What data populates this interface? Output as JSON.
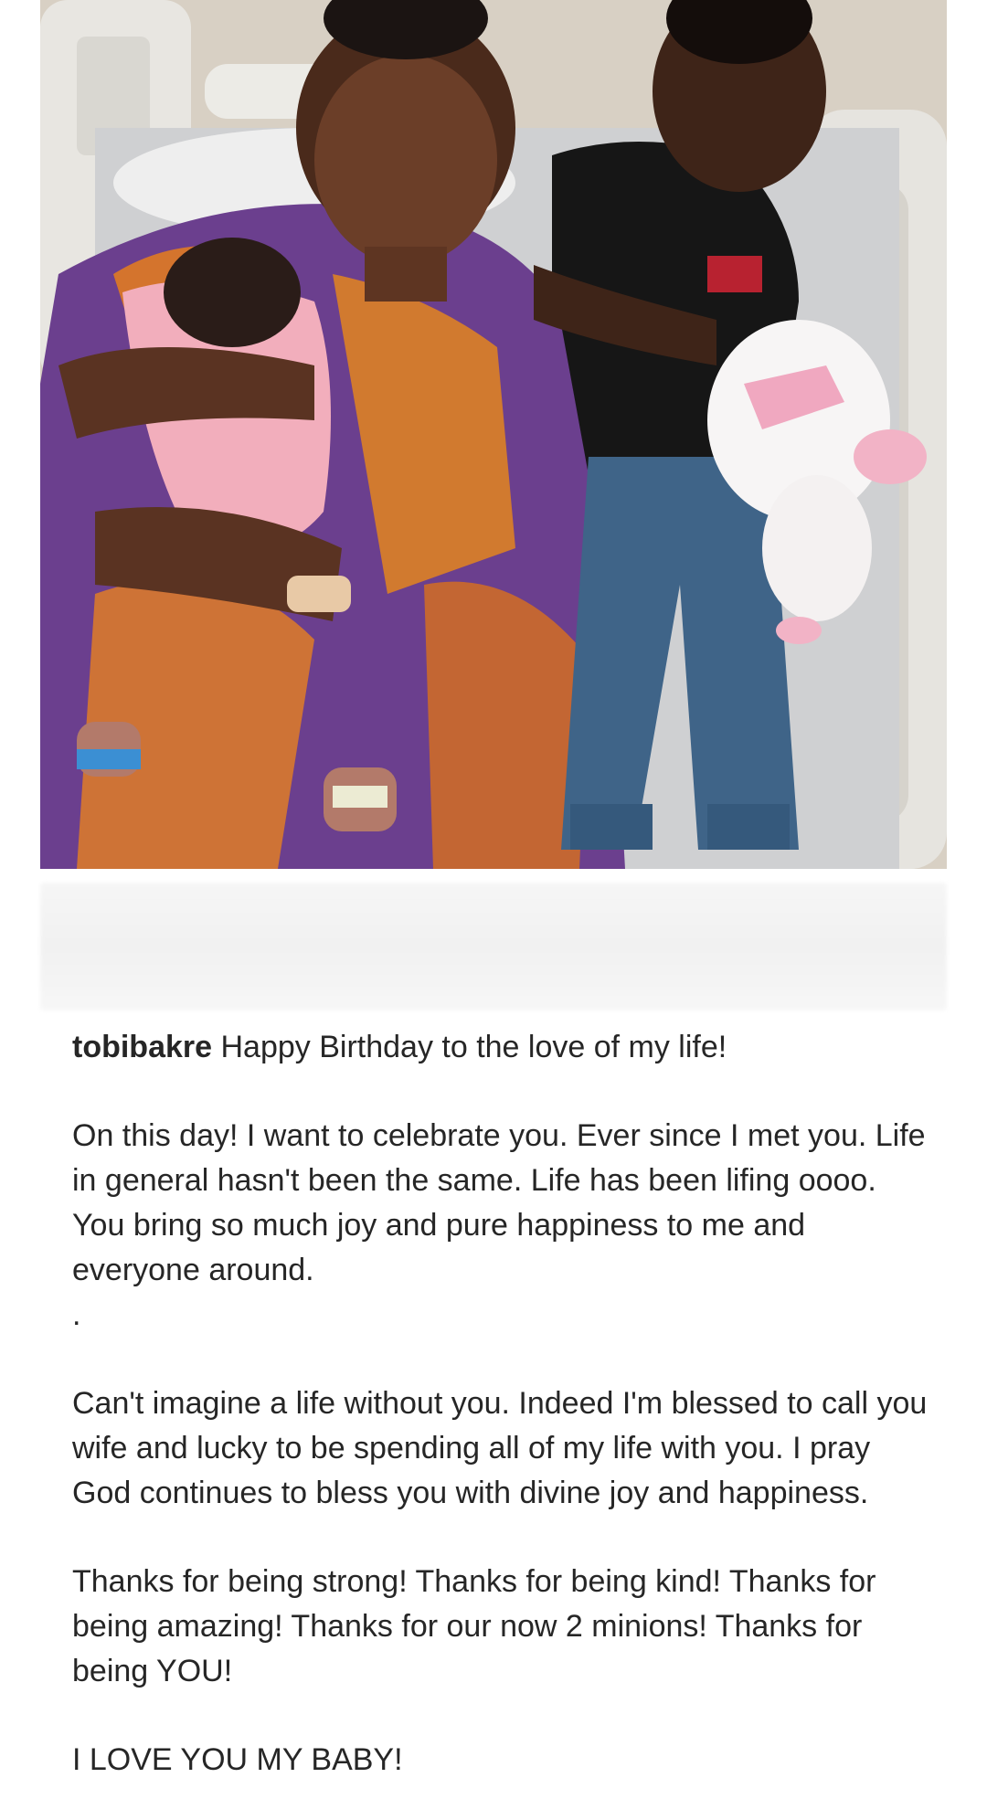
{
  "post": {
    "photo_alt": "",
    "username": "tobibakre",
    "caption_first_line": "Happy Birthday to the love of my life!",
    "paragraph_1": "On this day! I want to celebrate you. Ever since I met you. Life in general hasn't been the same. Life has been lifing oooo. You bring so much joy and pure happiness to me and everyone around.",
    "separator_dot": ".",
    "paragraph_2": "Can't imagine a life without you. Indeed I'm blessed to call you wife and lucky to be spending all of my life with you. I pray God continues to bless you with divine joy and happiness.",
    "paragraph_3": "Thanks for being strong! Thanks for being kind! Thanks for being amazing! Thanks for our now 2 minions! Thanks for being YOU!",
    "paragraph_4": "I LOVE YOU MY BABY!"
  },
  "colors": {
    "text": "#262626",
    "background": "#ffffff"
  }
}
